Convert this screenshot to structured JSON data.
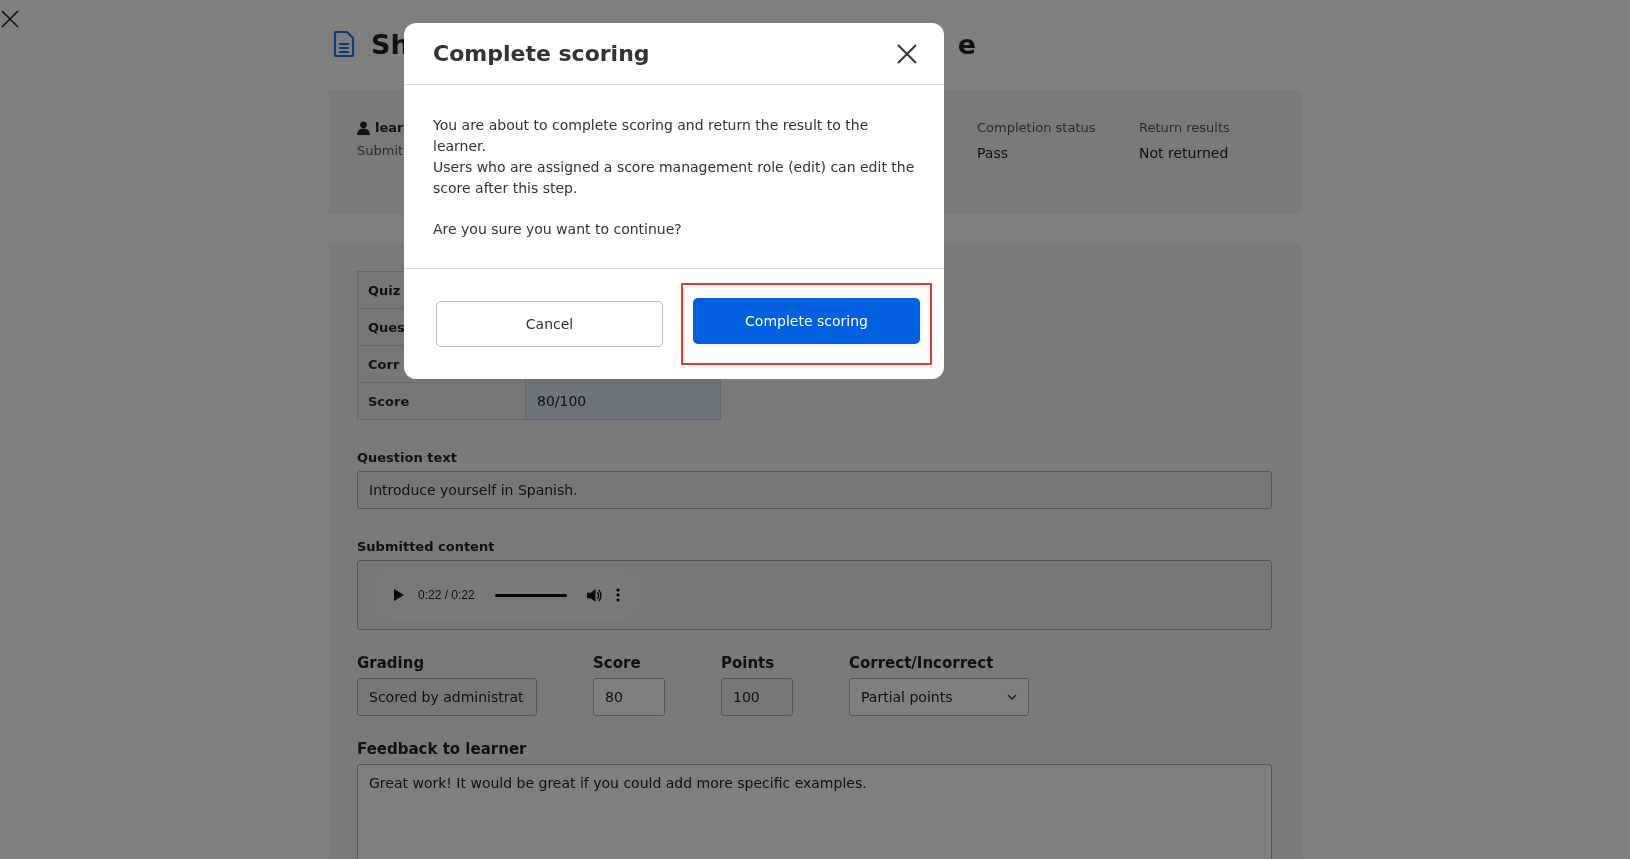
{
  "page": {
    "title_visible_start": "Sh",
    "title_visible_end": "e"
  },
  "summary": {
    "learner": "lear",
    "submitted_label": "Submit",
    "fields": [
      {
        "label": "Completion status",
        "value": "Pass"
      },
      {
        "label": "Return results",
        "value": "Not returned"
      }
    ]
  },
  "result_table": {
    "rows": [
      {
        "label": "Quiz",
        "value": ""
      },
      {
        "label": "Ques",
        "value": ""
      },
      {
        "label": "Corr",
        "value": ""
      },
      {
        "label": "Score",
        "value": "80/100"
      }
    ]
  },
  "question_text": {
    "label": "Question text",
    "value": "Introduce yourself in Spanish."
  },
  "submitted_content": {
    "label": "Submitted content",
    "player": {
      "time": "0:22 / 0:22",
      "level": 1
    }
  },
  "grading": {
    "label": "Grading",
    "value": "Scored by administrat"
  },
  "score": {
    "label": "Score",
    "value": "80"
  },
  "points": {
    "label": "Points",
    "value": "100"
  },
  "correctness": {
    "label": "Correct/Incorrect",
    "value": "Partial points"
  },
  "feedback": {
    "label": "Feedback to learner",
    "value": "Great work! It would be great if you could add more specific examples."
  },
  "dialog": {
    "title": "Complete scoring",
    "paragraphs": [
      "You are about to complete scoring and return the result to the learner.",
      "Users who are assigned a score management role (edit) can edit the score after this step.",
      "Are you sure you want to continue?"
    ],
    "buttons": [
      {
        "label": "Cancel",
        "kind": "secondary",
        "highlighted": false
      },
      {
        "label": "Complete scoring",
        "kind": "primary",
        "highlighted": true
      }
    ]
  }
}
